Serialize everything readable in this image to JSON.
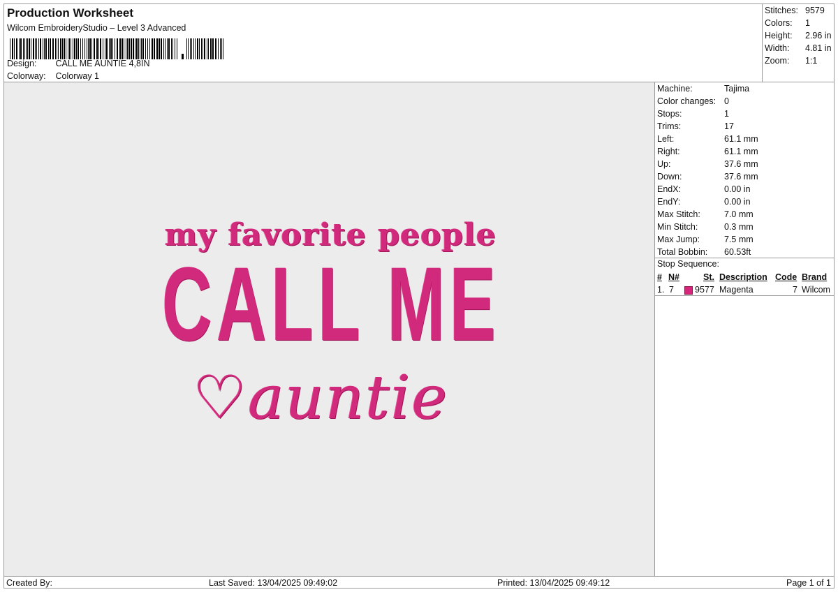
{
  "header": {
    "title": "Production Worksheet",
    "software": "Wilcom EmbroideryStudio – Level 3 Advanced",
    "design_label": "Design:",
    "design_value": "CALL ME AUNTIE 4,8IN",
    "colorway_label": "Colorway:",
    "colorway_value": "Colorway 1"
  },
  "stats": [
    {
      "label": "Stitches:",
      "value": "9579"
    },
    {
      "label": "Colors:",
      "value": "1"
    },
    {
      "label": "Height:",
      "value": "2.96 in"
    },
    {
      "label": "Width:",
      "value": "4.81 in"
    },
    {
      "label": "Zoom:",
      "value": "1:1"
    }
  ],
  "properties": [
    {
      "label": "Machine:",
      "value": "Tajima"
    },
    {
      "label": "Color changes:",
      "value": "0"
    },
    {
      "label": "Stops:",
      "value": "1"
    },
    {
      "label": "Trims:",
      "value": "17"
    },
    {
      "label": "Left:",
      "value": "61.1 mm"
    },
    {
      "label": "Right:",
      "value": "61.1 mm"
    },
    {
      "label": "Up:",
      "value": "37.6 mm"
    },
    {
      "label": "Down:",
      "value": "37.6 mm"
    },
    {
      "label": "EndX:",
      "value": "0.00 in"
    },
    {
      "label": "EndY:",
      "value": "0.00 in"
    },
    {
      "label": "Max Stitch:",
      "value": "7.0 mm"
    },
    {
      "label": "Min Stitch:",
      "value": "0.3 mm"
    },
    {
      "label": "Max Jump:",
      "value": "7.5 mm"
    },
    {
      "label": "Total Bobbin:",
      "value": "60.53ft"
    }
  ],
  "stop_sequence": {
    "title": "Stop Sequence:",
    "headers": {
      "num": "#",
      "n": "N#",
      "st": "St.",
      "description": "Description",
      "code": "Code",
      "brand": "Brand"
    },
    "rows": [
      {
        "num": "1.",
        "n": "7",
        "st": "9577",
        "description": "Magenta",
        "code": "7",
        "brand": "Wilcom",
        "color": "#d6257a"
      }
    ]
  },
  "design_text": {
    "line1": "my favorite people",
    "line2": "CALL ME",
    "line3": "♡auntie",
    "thread_color": "#d12a7c"
  },
  "footer": {
    "created_by": "Created By:",
    "last_saved": "Last Saved: 13/04/2025 09:49:02",
    "printed": "Printed: 13/04/2025 09:49:12",
    "page": "Page 1 of 1"
  }
}
